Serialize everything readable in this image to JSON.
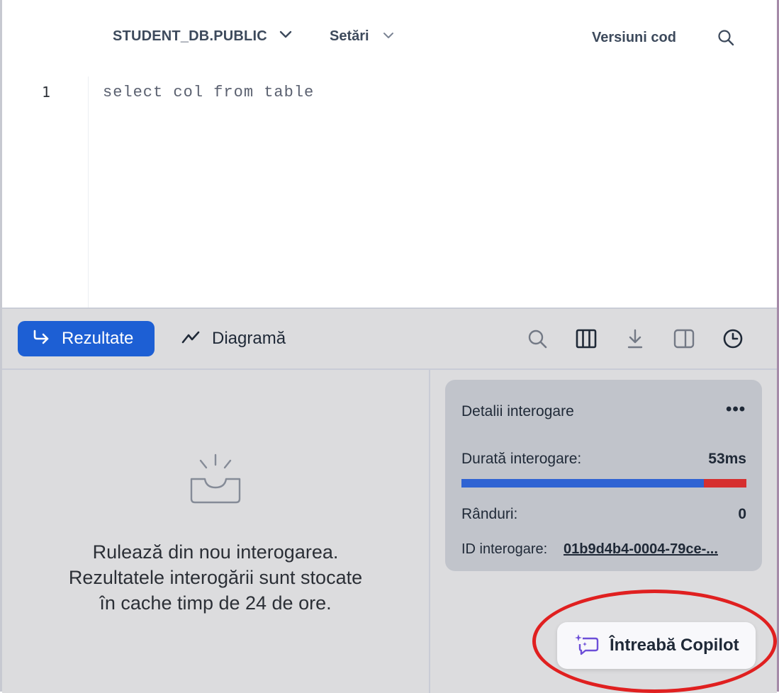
{
  "toolbar": {
    "database": "STUDENT_DB.PUBLIC",
    "settings_label": "Setări",
    "versions_label": "Versiuni cod"
  },
  "editor": {
    "line_number": "1",
    "code": "select col from table"
  },
  "results_tabs": {
    "results_label": "Rezultate",
    "chart_label": "Diagramă"
  },
  "empty_state": {
    "line1": "Rulează din nou interogarea.",
    "line2": "Rezultatele interogării sunt stocate",
    "line3": "în cache timp de 24 de ore."
  },
  "query_details": {
    "title": "Detalii interogare",
    "more": "•••",
    "duration_label": "Durată interogare:",
    "duration_value": "53ms",
    "duration_blue_fraction": 0.85,
    "rows_label": "Rânduri:",
    "rows_value": "0",
    "query_id_label": "ID interogare:",
    "query_id_value": "01b9d4b4-0004-79ce-..."
  },
  "copilot": {
    "label": "Întreabă Copilot"
  },
  "colors": {
    "accent": "#1d5fd4",
    "bar_blue": "#2f63d3",
    "bar_red": "#d62f2f",
    "highlight": "#e02020"
  }
}
